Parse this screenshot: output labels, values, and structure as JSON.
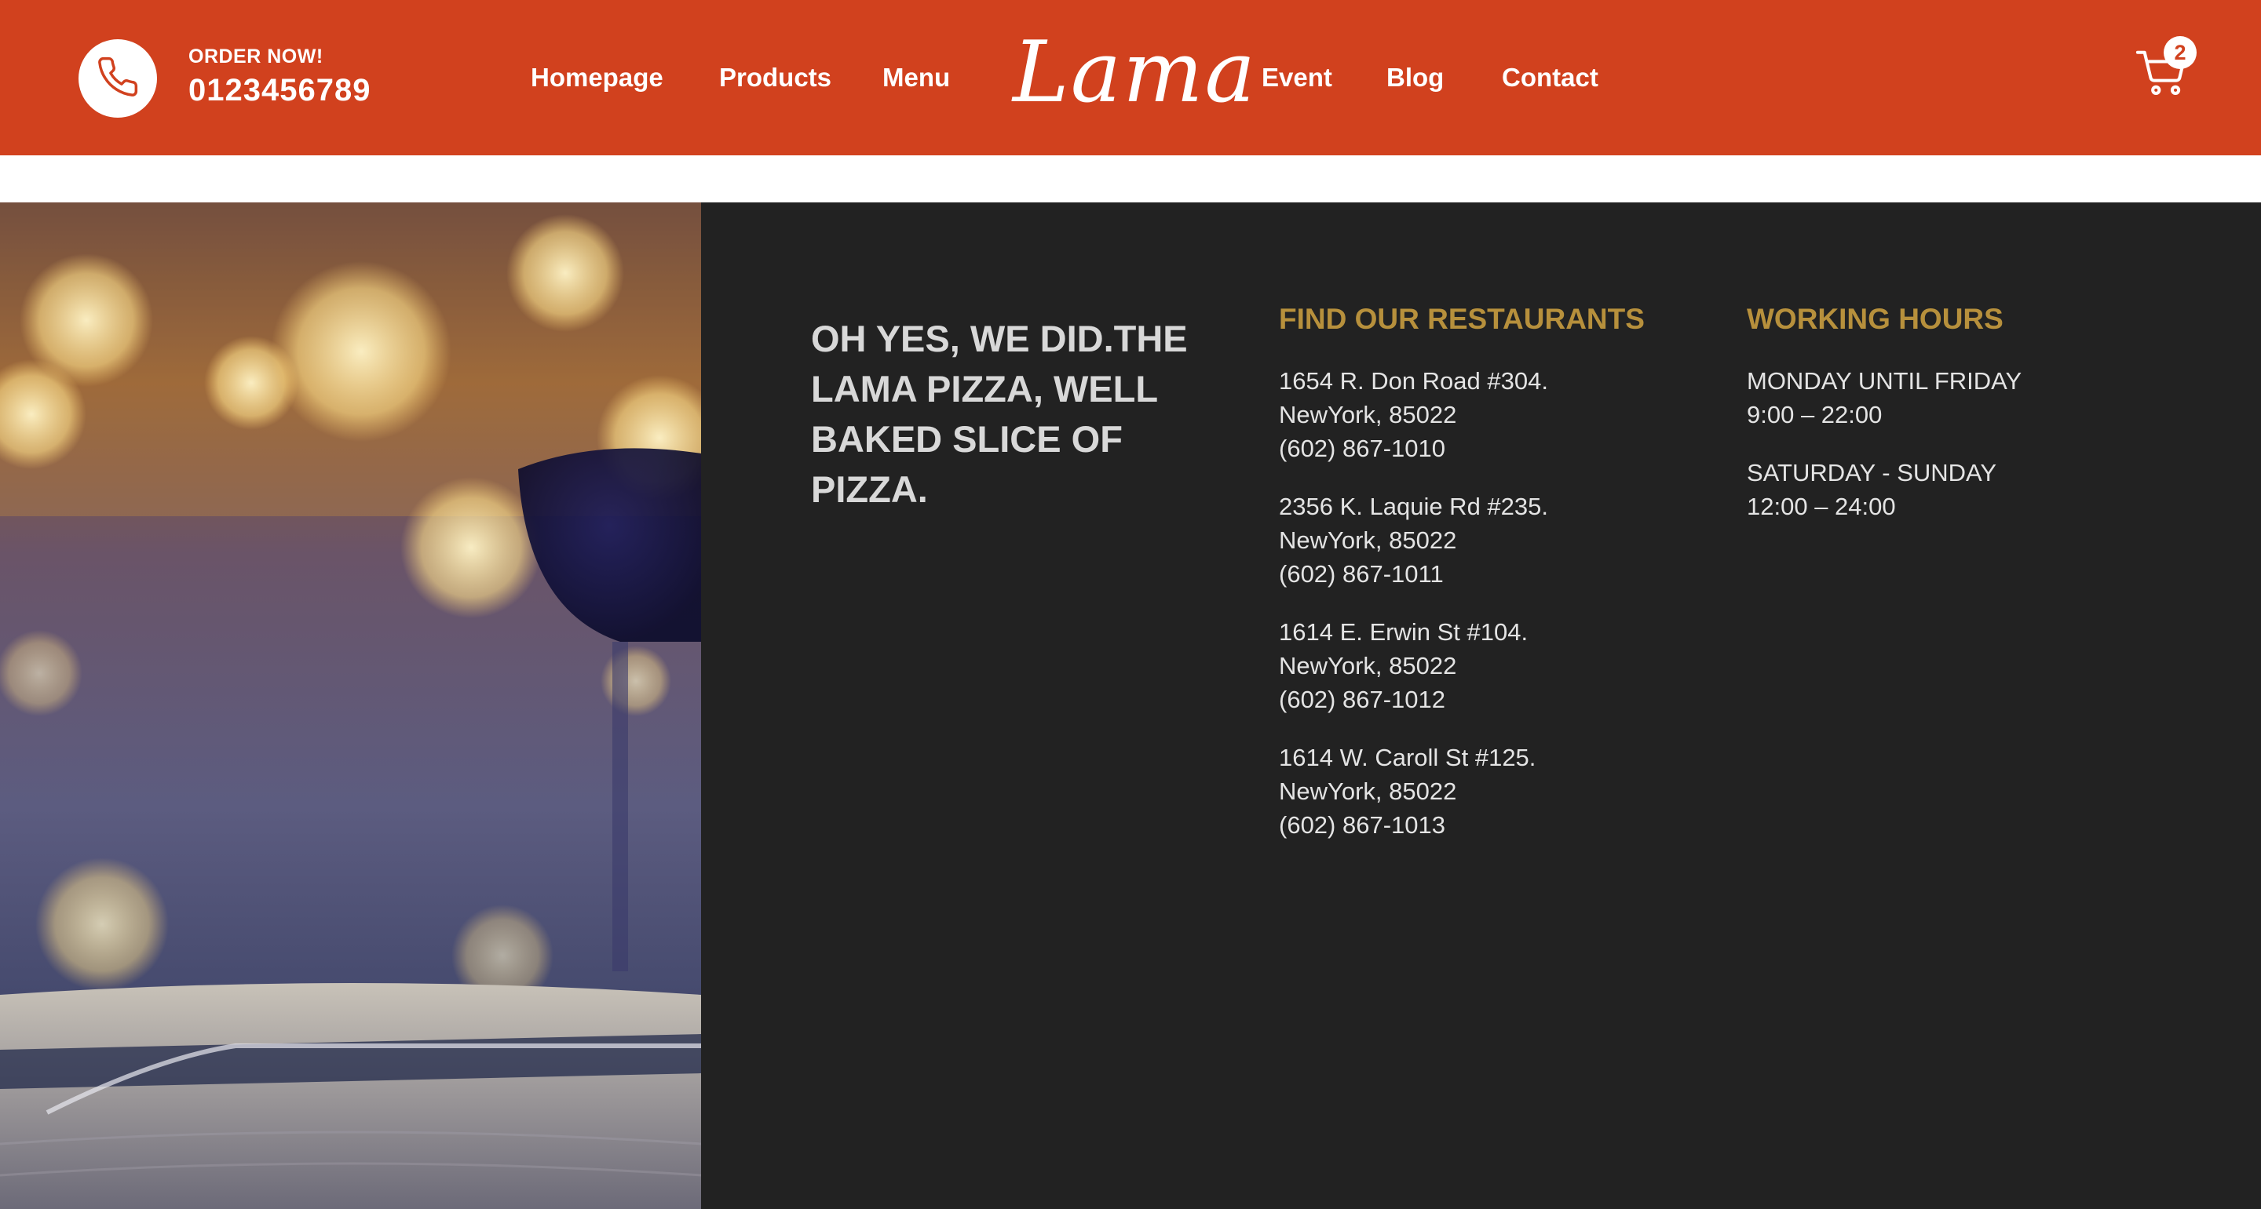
{
  "header": {
    "order_label": "ORDER NOW!",
    "phone": "0123456789",
    "nav_left": [
      "Homepage",
      "Products",
      "Menu"
    ],
    "logo": "Lama",
    "nav_right": [
      "Event",
      "Blog",
      "Contact"
    ],
    "cart_count": "2",
    "colors": {
      "bar": "#d1411e",
      "text": "#ffffff"
    }
  },
  "footer": {
    "tagline": "OH YES, WE DID.THE LAMA PIZZA, WELL BAKED SLICE OF PIZZA.",
    "restaurants": {
      "title": "FIND OUR RESTAURANTS",
      "items": [
        {
          "street": "1654 R. Don Road #304.",
          "city": "NewYork, 85022",
          "phone": "(602) 867-1010"
        },
        {
          "street": "2356 K. Laquie Rd #235.",
          "city": "NewYork, 85022",
          "phone": "(602) 867-1011"
        },
        {
          "street": "1614 E. Erwin St #104.",
          "city": "NewYork, 85022",
          "phone": "(602) 867-1012"
        },
        {
          "street": "1614 W. Caroll St #125.",
          "city": "NewYork, 85022",
          "phone": "(602) 867-1013"
        }
      ]
    },
    "hours": {
      "title": "WORKING HOURS",
      "items": [
        {
          "days": "MONDAY UNTIL FRIDAY",
          "time": "9:00 – 22:00"
        },
        {
          "days": "SATURDAY - SUNDAY",
          "time": "12:00 – 24:00"
        }
      ]
    },
    "colors": {
      "background": "#222222",
      "heading": "#b7903c",
      "text": "#e4e4e4"
    },
    "icons": [
      "phone-icon",
      "cart-icon"
    ]
  }
}
